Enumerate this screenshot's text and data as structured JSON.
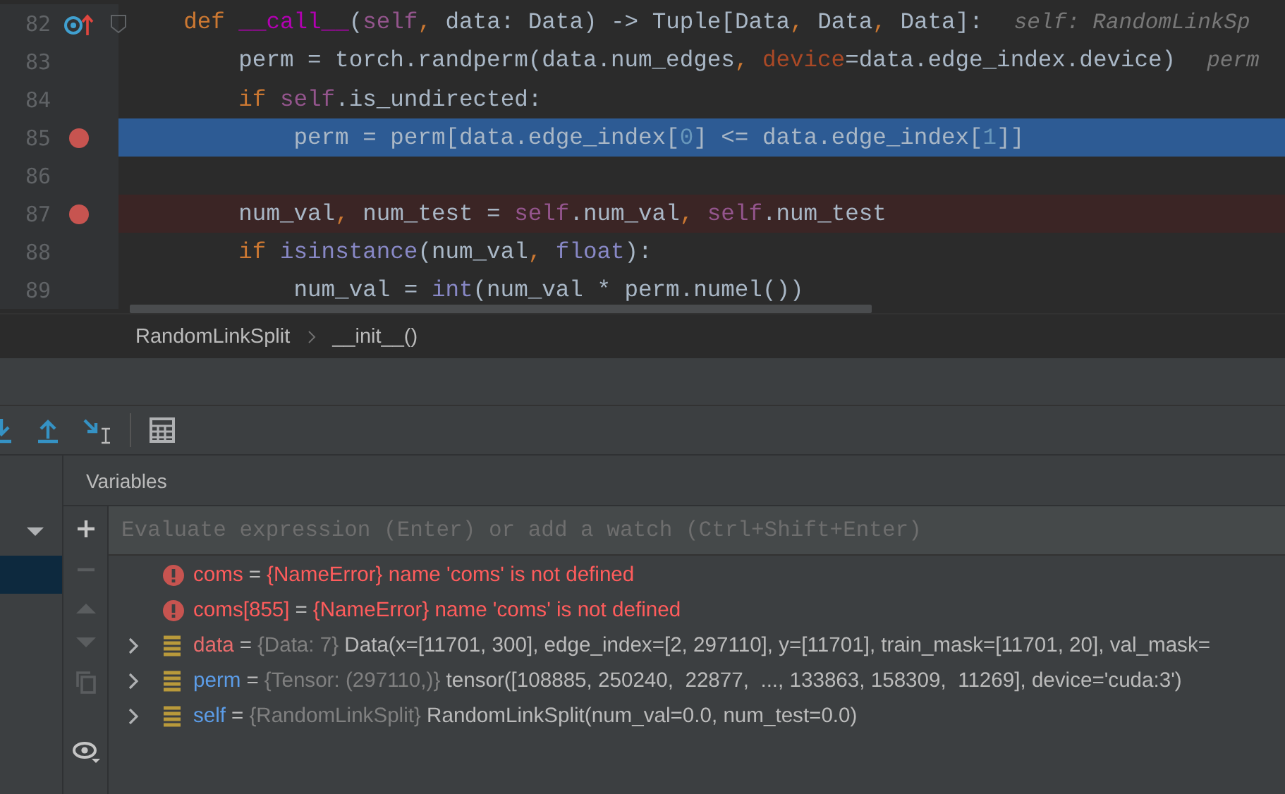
{
  "editor": {
    "lines": [
      {
        "number": "82",
        "override": true,
        "breakpoint": false,
        "current": false,
        "fold": true,
        "tokens": [
          {
            "kind": "keyword",
            "text": "    def "
          },
          {
            "kind": "magic",
            "text": "__call__"
          },
          {
            "kind": "plain",
            "text": "("
          },
          {
            "kind": "self",
            "text": "self"
          },
          {
            "kind": "punct",
            "text": ","
          },
          {
            "kind": "plain",
            "text": " data: Data) -> Tuple[Data"
          },
          {
            "kind": "punct",
            "text": ","
          },
          {
            "kind": "plain",
            "text": " Data"
          },
          {
            "kind": "punct",
            "text": ","
          },
          {
            "kind": "plain",
            "text": " Data]:"
          },
          {
            "kind": "hint",
            "text": "self: RandomLinkSp"
          }
        ]
      },
      {
        "number": "83",
        "override": false,
        "breakpoint": false,
        "current": false,
        "fold": false,
        "tokens": [
          {
            "kind": "plain",
            "text": "        perm = torch.randperm(data.num_edges"
          },
          {
            "kind": "punct",
            "text": ", "
          },
          {
            "kind": "kwarg",
            "text": "device"
          },
          {
            "kind": "plain",
            "text": "=data.edge_index.device)"
          },
          {
            "kind": "hint",
            "text": "perm"
          }
        ]
      },
      {
        "number": "84",
        "override": false,
        "breakpoint": false,
        "current": false,
        "fold": false,
        "tokens": [
          {
            "kind": "keyword",
            "text": "        if "
          },
          {
            "kind": "self",
            "text": "self"
          },
          {
            "kind": "plain",
            "text": ".is_undirected:"
          }
        ]
      },
      {
        "number": "85",
        "override": false,
        "breakpoint": true,
        "current": true,
        "fold": false,
        "tokens": [
          {
            "kind": "plain",
            "text": "            perm = perm[data.edge_index["
          },
          {
            "kind": "number",
            "text": "0"
          },
          {
            "kind": "plain",
            "text": "] <= data.edge_index["
          },
          {
            "kind": "number",
            "text": "1"
          },
          {
            "kind": "plain",
            "text": "]]"
          }
        ]
      },
      {
        "number": "86",
        "override": false,
        "breakpoint": false,
        "current": false,
        "fold": false
      },
      {
        "number": "87",
        "override": false,
        "breakpoint": true,
        "current": false,
        "fold": false,
        "tokens": [
          {
            "kind": "plain",
            "text": "        num_val"
          },
          {
            "kind": "punct",
            "text": ","
          },
          {
            "kind": "plain",
            "text": " num_test = "
          },
          {
            "kind": "self",
            "text": "self"
          },
          {
            "kind": "plain",
            "text": ".num_val"
          },
          {
            "kind": "punct",
            "text": ", "
          },
          {
            "kind": "self",
            "text": "self"
          },
          {
            "kind": "plain",
            "text": ".num_test"
          }
        ]
      },
      {
        "number": "88",
        "override": false,
        "breakpoint": false,
        "current": false,
        "fold": false,
        "tokens": [
          {
            "kind": "keyword",
            "text": "        if "
          },
          {
            "kind": "builtin",
            "text": "isinstance"
          },
          {
            "kind": "plain",
            "text": "(num_val"
          },
          {
            "kind": "punct",
            "text": ", "
          },
          {
            "kind": "builtin",
            "text": "float"
          },
          {
            "kind": "plain",
            "text": "):"
          }
        ]
      },
      {
        "number": "89",
        "override": false,
        "breakpoint": false,
        "current": false,
        "fold": false,
        "tokens": [
          {
            "kind": "plain",
            "text": "            num_val = "
          },
          {
            "kind": "builtin",
            "text": "int"
          },
          {
            "kind": "plain",
            "text": "(num_val * perm.numel())"
          }
        ]
      }
    ]
  },
  "breadcrumbs": [
    {
      "label": "RandomLinkSplit"
    },
    {
      "label": "__init__()"
    }
  ],
  "variables_panel": {
    "title": "Variables",
    "placeholder": "Evaluate expression (Enter) or add a watch (Ctrl+Shift+Enter)"
  },
  "variables": [
    {
      "kind": "error",
      "name": "coms",
      "operator": "=",
      "type": "{NameError}",
      "value": "name 'coms' is not defined"
    },
    {
      "kind": "error",
      "name": "coms[855]",
      "operator": "=",
      "type": "{NameError}",
      "value": "name 'coms' is not defined"
    },
    {
      "kind": "object",
      "name": "data",
      "operator": "=",
      "changed": true,
      "expanded": false,
      "type": "{Data: 7}",
      "value": "Data(x=[11701, 300], edge_index=[2, 297110], y=[11701], train_mask=[11701, 20], val_mask="
    },
    {
      "kind": "object",
      "name": "perm",
      "operator": "=",
      "changed": false,
      "expanded": false,
      "type": "{Tensor: (297110,)}",
      "value": "tensor([108885, 250240,  22877,  ..., 133863, 158309,  11269], device='cuda:3')"
    },
    {
      "kind": "object",
      "name": "self",
      "operator": "=",
      "changed": false,
      "expanded": false,
      "type": "{RandomLinkSplit}",
      "value": "RandomLinkSplit(num_val=0.0, num_test=0.0)"
    }
  ]
}
